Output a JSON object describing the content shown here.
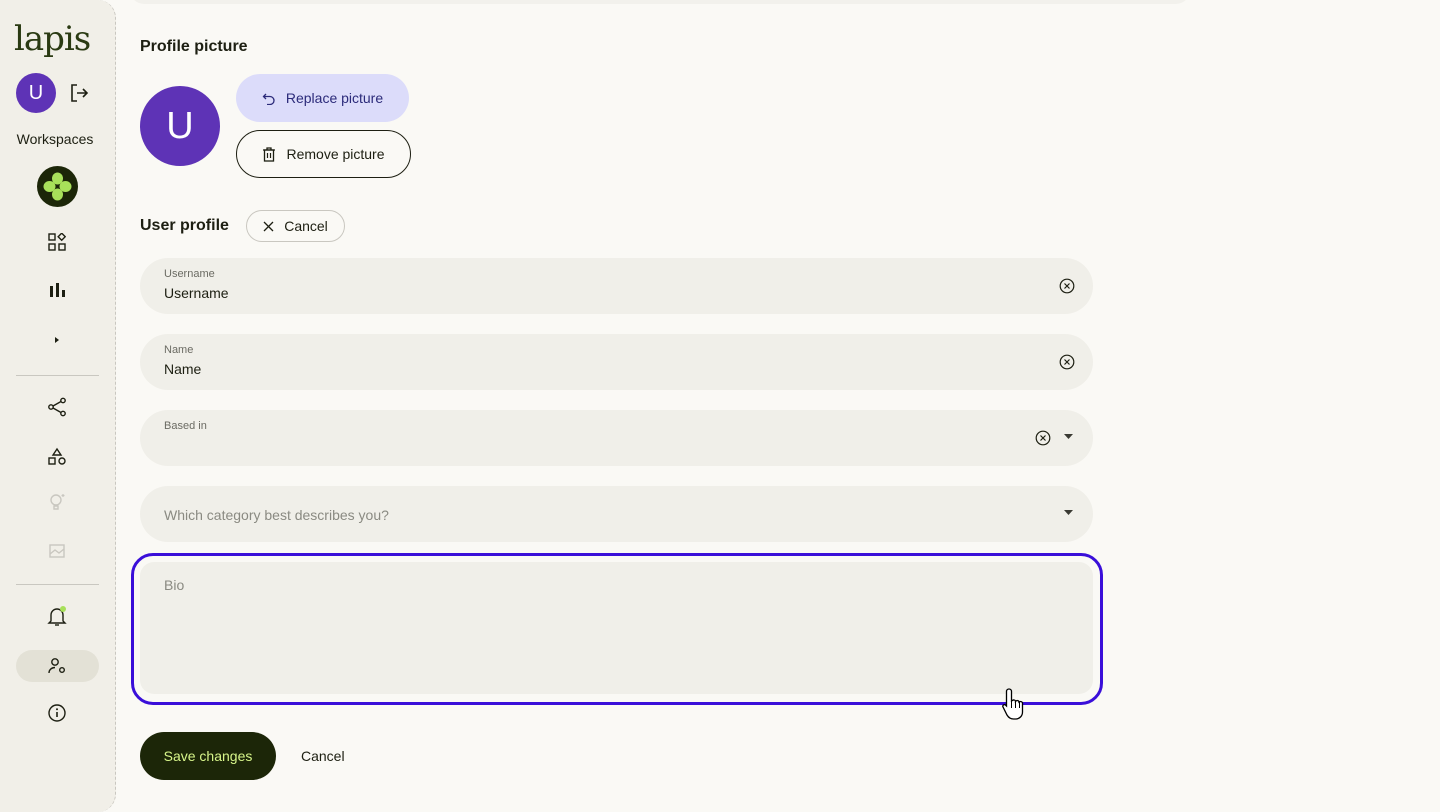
{
  "sidebar": {
    "logo": "lapis",
    "avatar_initial": "U",
    "workspaces_label": "Workspaces",
    "icons": [
      "logout-icon",
      "workspace-logo",
      "grid-icon",
      "bar-chart-icon",
      "chevron-right-icon",
      "share-icon",
      "shapes-icon",
      "bulb-icon",
      "image-icon",
      "bell-icon",
      "user-settings-icon",
      "info-icon"
    ]
  },
  "profile_picture": {
    "title": "Profile picture",
    "avatar_initial": "U",
    "replace_label": "Replace picture",
    "remove_label": "Remove picture"
  },
  "user_profile": {
    "title": "User profile",
    "cancel_label": "Cancel",
    "username": {
      "label": "Username",
      "value": "Username"
    },
    "name": {
      "label": "Name",
      "value": "Name"
    },
    "based_in": {
      "label": "Based in",
      "value": ""
    },
    "category": {
      "placeholder": "Which category best describes you?"
    },
    "bio": {
      "placeholder": "Bio"
    }
  },
  "footer": {
    "save_label": "Save changes",
    "cancel_label": "Cancel"
  },
  "colors": {
    "accent": "#5e33b6",
    "focus_ring": "#3a0fd9",
    "save_bg": "#1c2608",
    "save_text": "#d7f58a",
    "replace_bg": "#dcdcfa"
  }
}
